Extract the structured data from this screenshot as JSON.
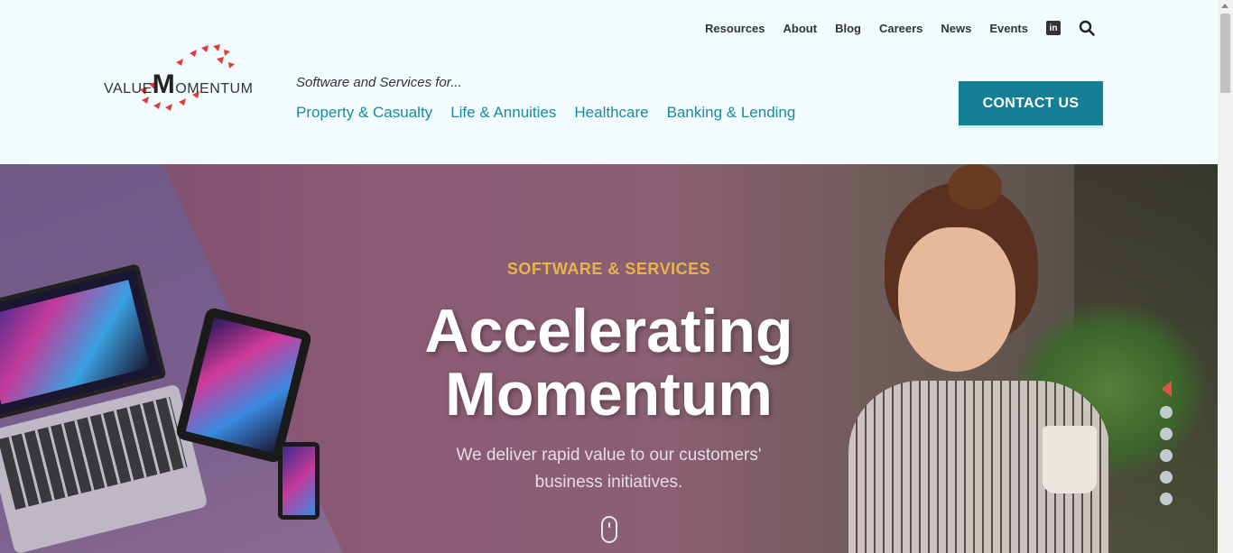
{
  "header": {
    "logo_text_1": "VALUE",
    "logo_text_2": "M",
    "logo_text_3": "OMENTUM",
    "top_nav": [
      "Resources",
      "About",
      "Blog",
      "Careers",
      "News",
      "Events"
    ],
    "linkedin_label": "in",
    "tagline": "Software and Services for...",
    "lob_nav": [
      "Property & Casualty",
      "Life & Annuities",
      "Healthcare",
      "Banking & Lending"
    ],
    "contact_label": "CONTACT US"
  },
  "hero": {
    "eyebrow": "SOFTWARE & SERVICES",
    "headline_line1": "Accelerating",
    "headline_line2": "Momentum",
    "sub_line1": "We deliver rapid value to our customers'",
    "sub_line2": "business initiatives."
  },
  "carousel": {
    "slide_count": 5,
    "active_index": 0
  },
  "colors": {
    "accent": "#137e94",
    "link": "#1a8a9e",
    "eyebrow": "#e8b44a",
    "arrow": "#e0524a"
  }
}
